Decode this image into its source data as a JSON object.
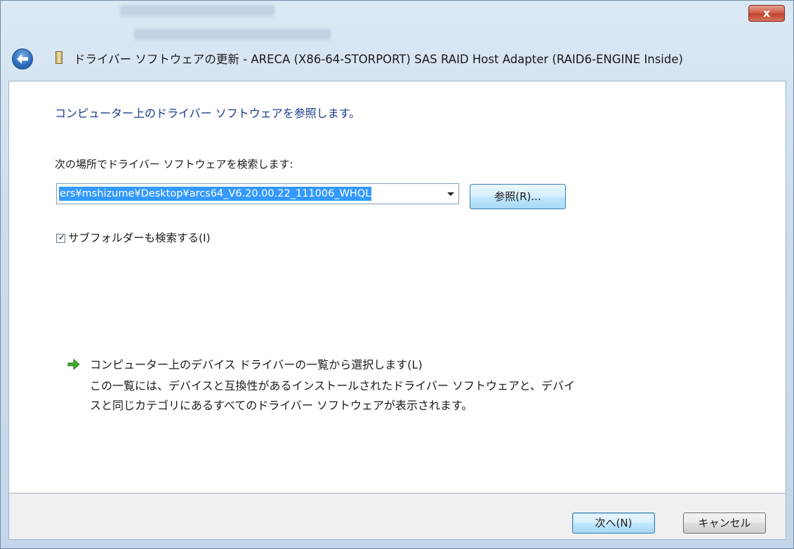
{
  "window": {
    "title": "ドライバー ソフトウェアの更新 - ARECA (X86-64-STORPORT) SAS RAID Host Adapter (RAID6-ENGINE Inside)",
    "close_label": "x"
  },
  "content": {
    "heading": "コンピューター上のドライバー ソフトウェアを参照します。",
    "search_label": "次の場所でドライバー ソフトウェアを検索します:",
    "path_value": "ers¥mshizume¥Desktop¥arcs64_V6.20.00.22_111006_WHQL",
    "browse_label": "参照(R)...",
    "include_subfolders": {
      "label": "サブフォルダーも検索する(I)",
      "checked": true
    },
    "pick_from_list": {
      "title": "コンピューター上のデバイス ドライバーの一覧から選択します(L)",
      "description": "この一覧には、デバイスと互換性があるインストールされたドライバー ソフトウェアと、デバイスと同じカテゴリにあるすべてのドライバー ソフトウェアが表示されます。"
    }
  },
  "footer": {
    "next_label": "次へ(N)",
    "cancel_label": "キャンセル"
  },
  "icons": {
    "back": "back-arrow-icon",
    "device": "device-icon",
    "green_arrow": "green-arrow-icon"
  },
  "colors": {
    "heading": "#1a3c8a",
    "selection": "#3399ff",
    "close_button": "#c1432d"
  }
}
